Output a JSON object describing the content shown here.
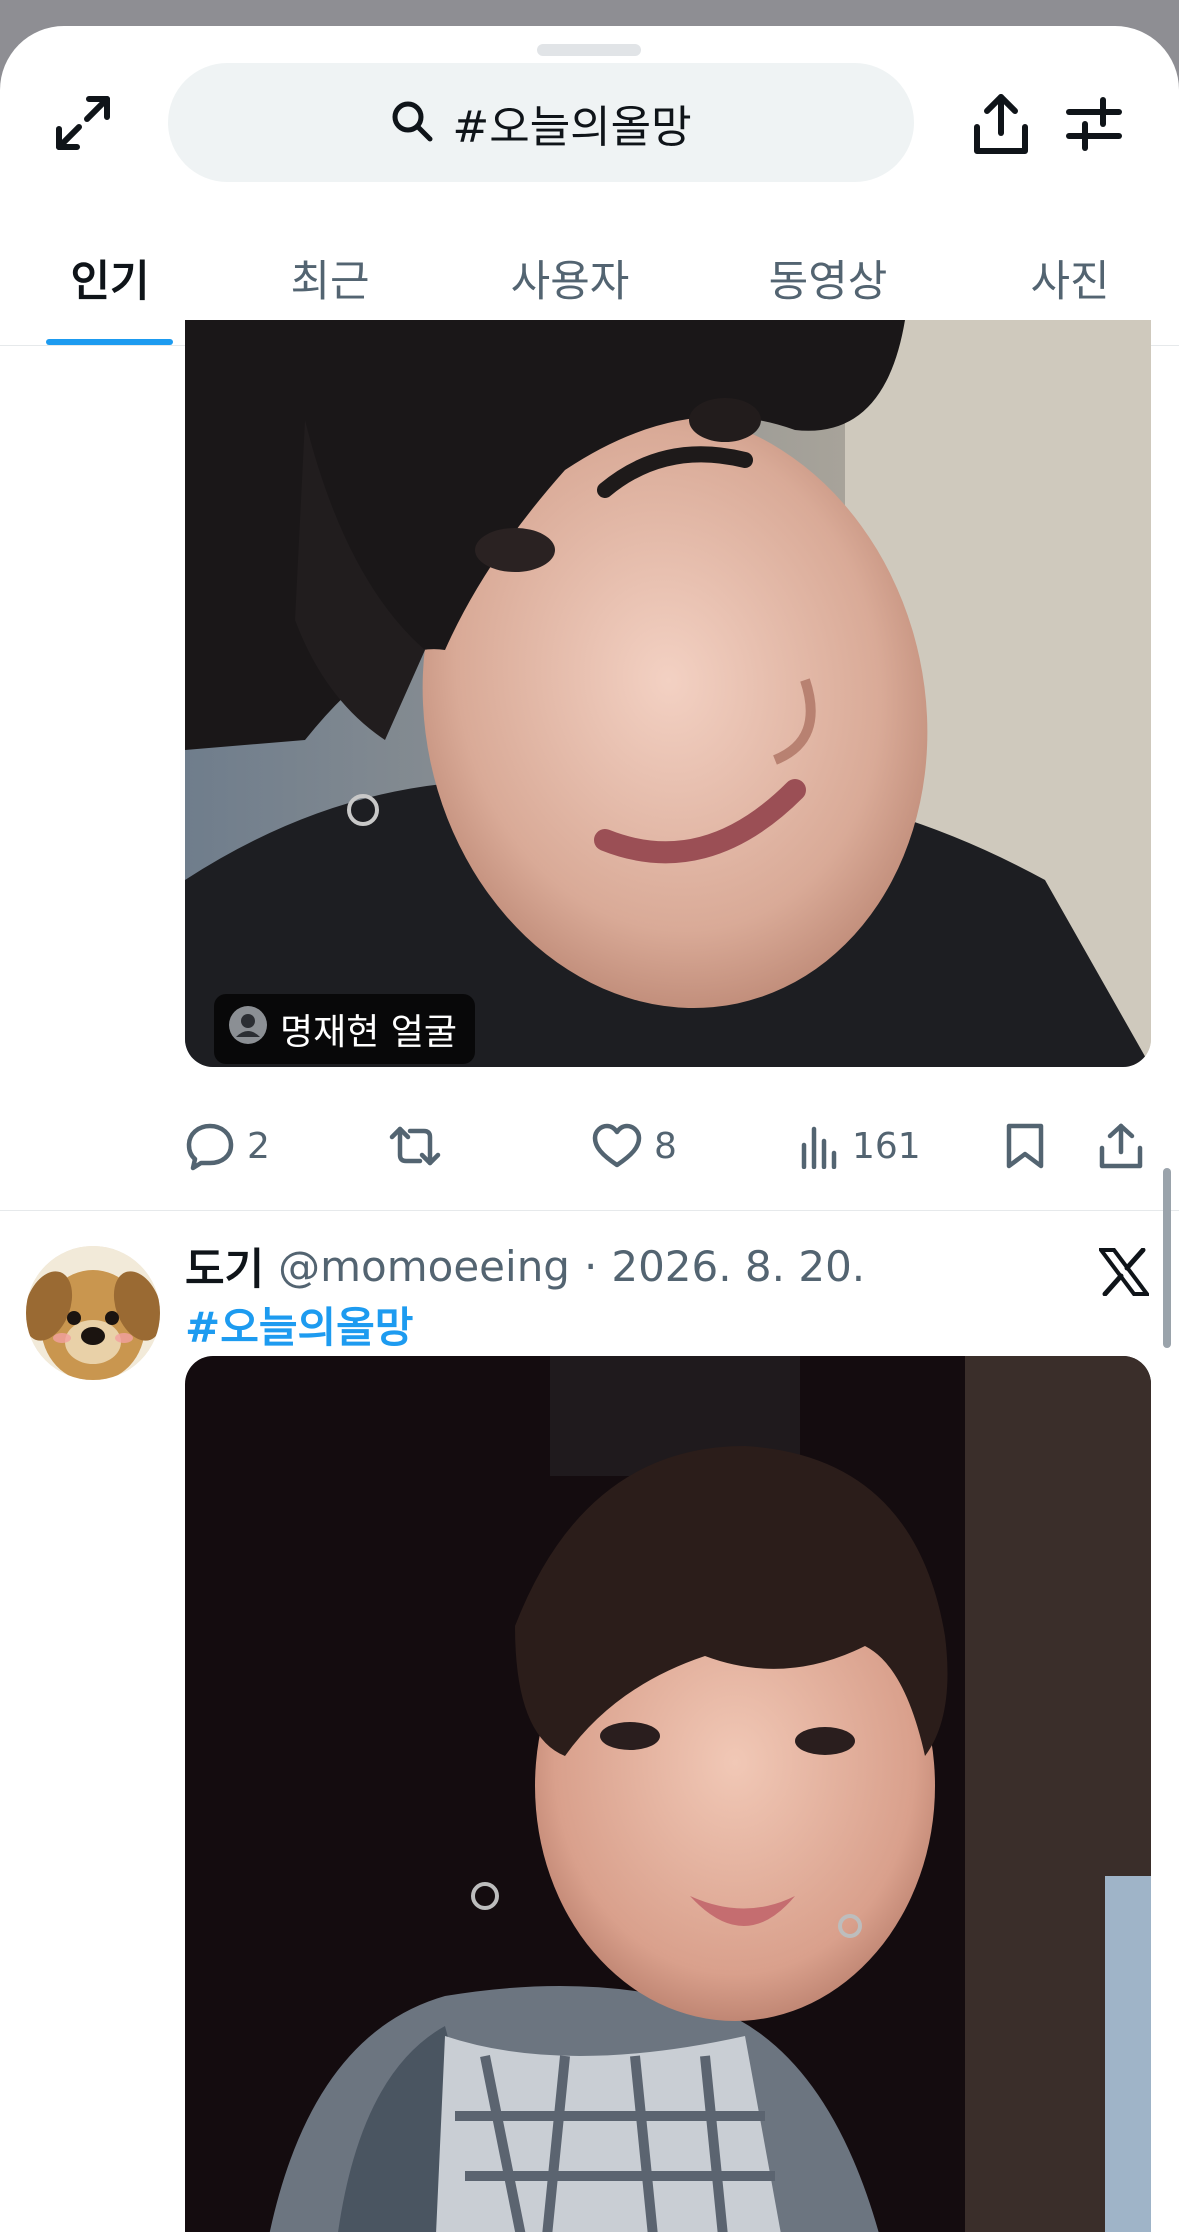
{
  "search": {
    "query": "#오늘의올망"
  },
  "tabs": [
    {
      "label": "인기",
      "active": true
    },
    {
      "label": "최근",
      "active": false
    },
    {
      "label": "사용자",
      "active": false
    },
    {
      "label": "동영상",
      "active": false
    },
    {
      "label": "사진",
      "active": false
    }
  ],
  "post1": {
    "tag_label": "명재현 얼굴",
    "replies": "2",
    "likes": "8",
    "views": "161"
  },
  "post2": {
    "username": "도기",
    "handle": "@momoeeing",
    "separator": "·",
    "date": "2026. 8. 20.",
    "hashtag": "#오늘의올망"
  },
  "colors": {
    "accent": "#1d9bf0",
    "secondary_text": "#536471",
    "search_bg": "#eff3f4"
  },
  "icons": [
    "expand-icon",
    "search-icon",
    "share-icon",
    "filter-icon",
    "reply-icon",
    "retweet-icon",
    "like-icon",
    "views-icon",
    "bookmark-icon",
    "x-logo-icon",
    "person-tag-icon"
  ]
}
